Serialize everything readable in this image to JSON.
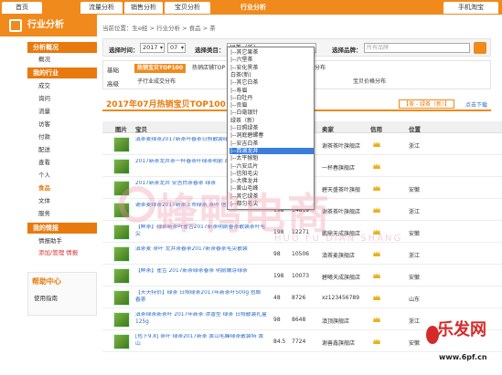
{
  "topnav": {
    "tabs": [
      {
        "label": "首页",
        "active": false
      },
      {
        "label": "流量分析",
        "active": false
      },
      {
        "label": "销售分析",
        "active": false
      },
      {
        "label": "宝贝分析",
        "active": false
      },
      {
        "label": "行业分析",
        "active": true
      }
    ],
    "mobile": "手机淘宝"
  },
  "sidebar": {
    "title": "行业分析",
    "sections": [
      {
        "title": "分析概况",
        "items": [
          "概况"
        ]
      },
      {
        "title": "我的行业",
        "items": [
          "成交",
          "询问",
          "流量",
          "访客",
          "付款",
          "配送",
          "查看",
          "个人",
          "收藏",
          "类目",
          "文体",
          "服务"
        ]
      },
      {
        "title": "我的情报",
        "items": [
          "情报助手",
          "添加/管理 情报"
        ]
      }
    ],
    "active_item": "食品",
    "help": {
      "title": "帮助中心",
      "item": "使用指南"
    }
  },
  "main": {
    "breadcrumb": "当前位置：生e经 > 行业分析 > 食品 > 茶",
    "filter": {
      "time_label": "选择时间：",
      "year": "2017",
      "month": "07",
      "category_label": "选择类目：",
      "category_value": "绿茶（新）",
      "brand_label": "选择品牌：",
      "brand_placeholder": "所有品牌"
    },
    "subnav": {
      "row1_label": "基础",
      "row1_items": [
        "热销宝贝TOP100",
        "热销店铺TOP",
        "城市分布"
      ],
      "row2_label": "高级",
      "row2_items": [
        "子行业成交分布",
        "宝贝价格分布"
      ]
    },
    "report": {
      "title": "2017年07月热销宝贝TOP100",
      "tag": "【茶 - 绿茶（新）】",
      "download": "点击下载"
    },
    "table": {
      "headers": [
        "图片",
        "宝贝",
        "",
        "",
        "卖家",
        "信用",
        "位置"
      ],
      "rows": [
        {
          "title": "滇茶麦绿茶2017新茶叶春茶日照散装绿茶新茶",
          "price": "",
          "sales": "",
          "shop": "谢茶茶叶旗舰店",
          "loc": "浙江"
        },
        {
          "title": "2017新茶龙井茶一杯春茶叶绿茶明前 西湖龙井200g",
          "price": "",
          "sales": "",
          "shop": "一杯春旗舰店",
          "loc": ""
        },
        {
          "title": "2017新茶龙井 安吉白茶春茶 绿茶",
          "price": "",
          "sales": "",
          "shop": "碧天盛茶叶旗舰",
          "loc": "安徽"
        },
        {
          "title": "谢茶麦绿茶2017新茶上市绿茶 茶叶 信阳毛尖春茶礼盒",
          "price": "198",
          "sales": "14819",
          "shop": "谢茶茶叶旗舰店",
          "loc": "浙江"
        },
        {
          "title": "【鲜茶】绿茶新茶叶雀舌2017新茶明前春茶散装茶叶毛尖",
          "price": "198",
          "sales": "12271",
          "shop": "鹏鼎天成旗舰店",
          "loc": "安徽"
        },
        {
          "title": "滇茶麦 茶叶 龙井茶春茶2017新茶春茶毛尖散装",
          "price": "98",
          "sales": "10506",
          "shop": "滇茶麦旗舰店",
          "loc": "浙江"
        },
        {
          "title": "【鲜茶】雀舌 2017新茶绿茶春茶 明前嫩芽绿茶",
          "price": "198",
          "sales": "10073",
          "shop": "碧曦天成旗舰店",
          "loc": "安徽"
        },
        {
          "title": "【天天特价】绿茶 日照绿茶2017年新茶叶500g 包邮 春茶",
          "price": "48",
          "sales": "8726",
          "shop": "xz123456789",
          "loc": "山东"
        },
        {
          "title": "滇茶绿茶新茶叶 2017年新茶 浓香型 绿茶 日照散装礼盒125g",
          "price": "98",
          "sales": "8648",
          "shop": "滇顶旗舰店",
          "loc": "浙江"
        },
        {
          "title": "[包下9.8] 茶叶 绿茶2017新茶 黄山毛峰绿茶散装特 黄山",
          "price": "84.5",
          "sales": "7724",
          "shop": "谢善鑫旗舰店",
          "loc": "安徽"
        }
      ]
    }
  },
  "dropdown": {
    "options": [
      "|--其它果茶",
      "|--六堡茶",
      "|--安化黑茶",
      "白茶(新)",
      "|--其它白茶",
      "|--寿眉",
      "|--白牡丹",
      "|--贡眉",
      "|--白毫银针",
      "绿茶（新）",
      "|--日照绿茶",
      "|--洞庭碧螺春",
      "|--安吉白茶",
      "|--西湖龙井",
      "|--太平猴魁",
      "|--六安瓜片",
      "|--信阳毛尖",
      "|--大佛龙井",
      "|--黄山毛峰",
      "|--其它绿茶",
      "|--都匀毛尖"
    ],
    "selected_index": 13
  },
  "watermark": {
    "big": "蜂鸭电商",
    "pinyin": "HUO FU DIAN SHANG"
  },
  "brand": {
    "name": "乐发网",
    "url": "www.6pf.cn"
  },
  "colors": {
    "accent": "#f08a1c",
    "link": "#2a6cc9",
    "highlight": "#3b7ddd"
  }
}
